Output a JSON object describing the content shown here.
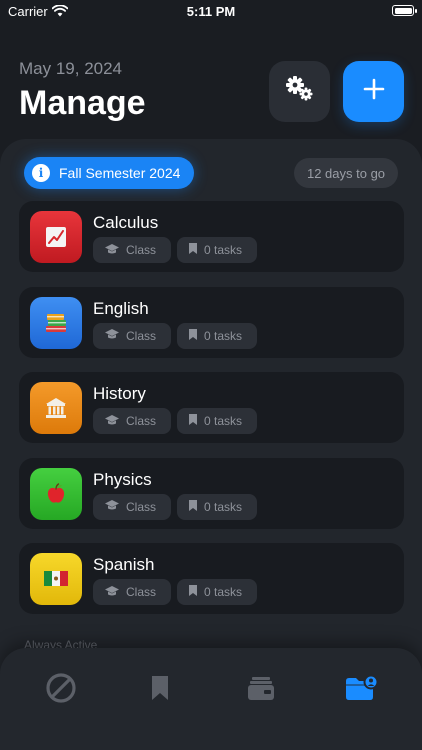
{
  "status_bar": {
    "carrier": "Carrier",
    "time": "5:11 PM"
  },
  "header": {
    "date": "May 19, 2024",
    "title": "Manage"
  },
  "semester": {
    "label": "Fall Semester 2024",
    "countdown": "12 days to go"
  },
  "classes": [
    {
      "name": "Calculus",
      "type": "Class",
      "tasks": "0 tasks",
      "color": "#d8262c",
      "icon": "chart-icon"
    },
    {
      "name": "English",
      "type": "Class",
      "tasks": "0 tasks",
      "color": "#2e7dea",
      "icon": "books-icon"
    },
    {
      "name": "History",
      "type": "Class",
      "tasks": "0 tasks",
      "color": "#ee8a14",
      "icon": "classical-building-icon"
    },
    {
      "name": "Physics",
      "type": "Class",
      "tasks": "0 tasks",
      "color": "#35c133",
      "icon": "apple-icon"
    },
    {
      "name": "Spanish",
      "type": "Class",
      "tasks": "0 tasks",
      "color": "#f1cc16",
      "icon": "mexico-flag-icon"
    }
  ],
  "section": {
    "always_active": "Always Active"
  },
  "colors": {
    "accent": "#1a8cff",
    "background": "#1a1d22",
    "sheet": "#22262c",
    "card": "#181b20"
  },
  "tabs": [
    {
      "icon": "prohibited-icon",
      "active": false
    },
    {
      "icon": "bookmark-icon",
      "active": false
    },
    {
      "icon": "wallet-icon",
      "active": false
    },
    {
      "icon": "folder-person-icon",
      "active": true
    }
  ]
}
